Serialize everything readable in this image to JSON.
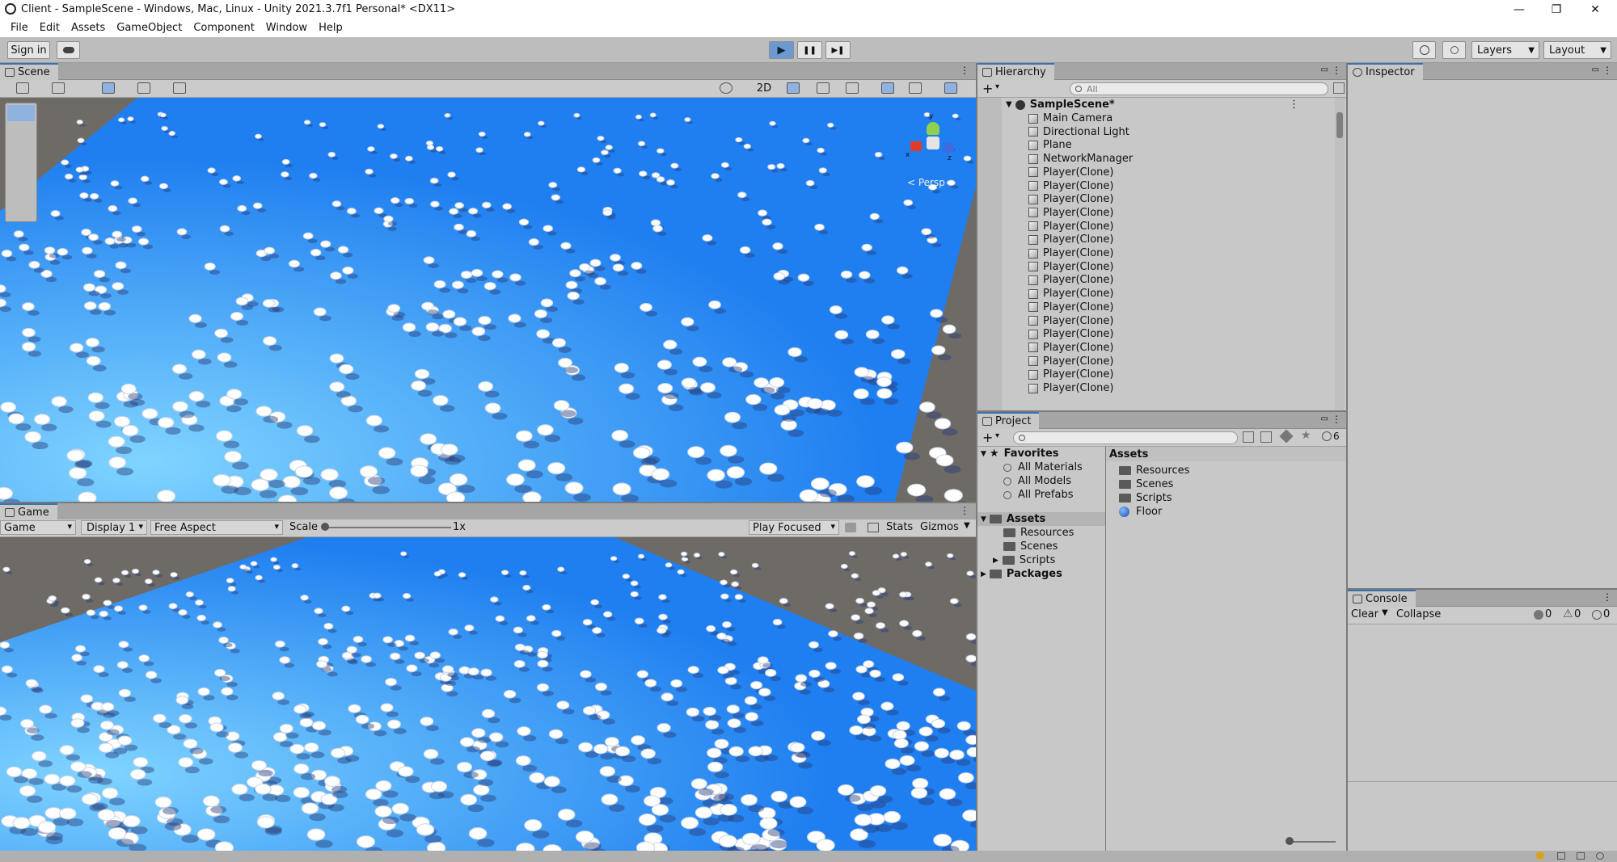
{
  "window": {
    "title": "Client - SampleScene - Windows, Mac, Linux - Unity 2021.3.7f1 Personal* <DX11>",
    "minimize": "—",
    "maximize": "❐",
    "close": "✕"
  },
  "menu": [
    "File",
    "Edit",
    "Assets",
    "GameObject",
    "Component",
    "Window",
    "Help"
  ],
  "toolbar": {
    "sign_in": "Sign in",
    "layers": "Layers",
    "layout": "Layout",
    "play": "▶",
    "pause": "❚❚",
    "step": "▶❚"
  },
  "scene": {
    "tab": "Scene",
    "mode_2d": "2D",
    "persp": "< Persp",
    "gizmo_y": "y",
    "gizmo_x": "x",
    "gizmo_z": "z"
  },
  "game": {
    "tab": "Game",
    "view": "Game",
    "display": "Display 1",
    "aspect": "Free Aspect",
    "scale_label": "Scale",
    "scale_value": "1x",
    "play_mode": "Play Focused",
    "stats": "Stats",
    "gizmos": "Gizmos"
  },
  "hierarchy": {
    "tab": "Hierarchy",
    "search_placeholder": "All",
    "scene": "SampleScene*",
    "items": [
      "Main Camera",
      "Directional Light",
      "Plane",
      "NetworkManager",
      "Player(Clone)",
      "Player(Clone)",
      "Player(Clone)",
      "Player(Clone)",
      "Player(Clone)",
      "Player(Clone)",
      "Player(Clone)",
      "Player(Clone)",
      "Player(Clone)",
      "Player(Clone)",
      "Player(Clone)",
      "Player(Clone)",
      "Player(Clone)",
      "Player(Clone)",
      "Player(Clone)",
      "Player(Clone)",
      "Player(Clone)"
    ]
  },
  "project": {
    "tab": "Project",
    "favorites": "Favorites",
    "fav_items": [
      "All Materials",
      "All Models",
      "All Prefabs"
    ],
    "assets": "Assets",
    "asset_folders": [
      "Resources",
      "Scenes",
      "Scripts"
    ],
    "packages": "Packages",
    "hidden_count": "6",
    "right_header": "Assets",
    "right_items": [
      "Resources",
      "Scenes",
      "Scripts",
      "Floor"
    ]
  },
  "inspector": {
    "tab": "Inspector"
  },
  "console": {
    "tab": "Console",
    "clear": "Clear",
    "collapse": "Collapse",
    "errors": "0",
    "warnings": "0",
    "infos": "0"
  },
  "colors": {
    "accent": "#3a72b0",
    "plane_light": "#7fd4ff",
    "plane_dark": "#1f7ff0",
    "ground": "#6e6a66"
  }
}
